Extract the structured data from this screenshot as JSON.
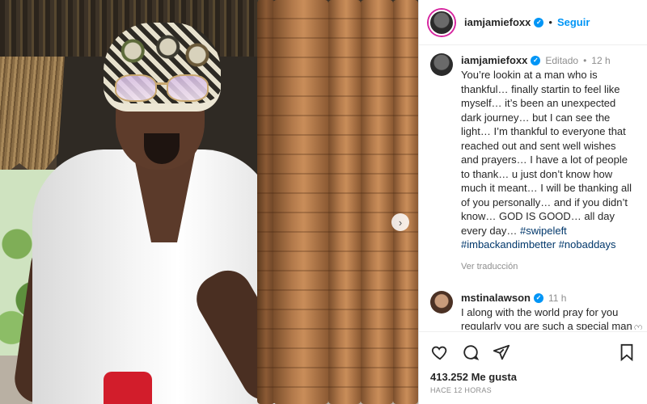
{
  "post": {
    "author": "iamjamiefoxx",
    "follow_label": "Seguir",
    "separator": "•"
  },
  "caption": {
    "author": "iamjamiefoxx",
    "edited_label": "Editado",
    "time": "12 h",
    "text": "You’re lookin at a man who is thankful… finally startin to feel like myself… it’s been an unexpected dark journey… but I can see the light… I’m thankful to everyone that reached out and sent well wishes and prayers… I have a lot of people to thank… u just don’t know how much it meant… I will be thanking all of you personally… and if you didn’t know… GOD IS GOOD… all day every day… ",
    "hashtags": [
      "#swipeleft",
      "#imbackandimbetter",
      "#nobaddays"
    ],
    "see_translation": "Ver traducción"
  },
  "comments": [
    {
      "author": "mstinalawson",
      "time": "11 h",
      "text": "I along with the world pray for you regularly you are such a special man such a gift to the world of entertainment. God bless you love,"
    }
  ],
  "actions": {
    "likes": "413.252 Me gusta",
    "posted": "Hace 12 horas"
  },
  "icons": {
    "verified": "verified-badge-icon",
    "like": "heart-icon",
    "comment": "comment-bubble-icon",
    "share": "paper-plane-icon",
    "save": "bookmark-icon",
    "next": "chevron-right-icon"
  },
  "colors": {
    "link": "#0095f6",
    "hashtag": "#00376b",
    "muted": "#8e8e8e"
  }
}
